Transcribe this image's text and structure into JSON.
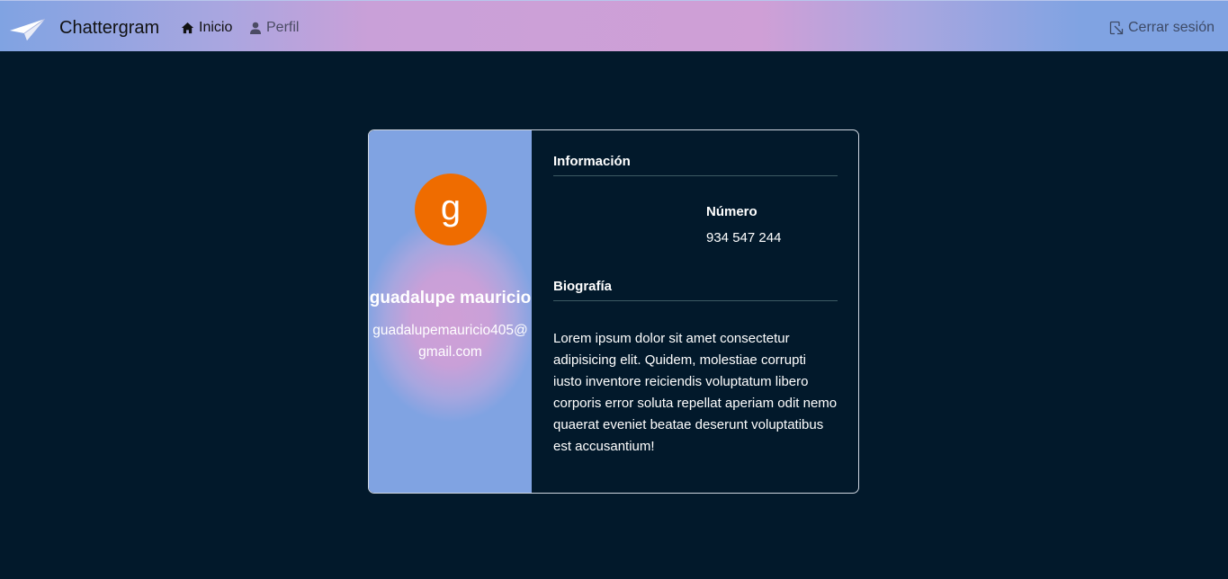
{
  "navbar": {
    "brand": "Chattergram",
    "links": [
      {
        "label": "Inicio",
        "icon": "home-icon"
      },
      {
        "label": "Perfil",
        "icon": "user-icon"
      }
    ],
    "logout": {
      "label": "Cerrar sesión",
      "icon": "logout-icon"
    }
  },
  "profile": {
    "avatar_letter": "g",
    "avatar_color": "#ef6c00",
    "name": "guadalupe mauricio",
    "email_line1": "guadalupemauricio405@",
    "email_line2": "gmail.com"
  },
  "info": {
    "section_title": "Información",
    "number_label": "Número",
    "number_value": "934 547 244"
  },
  "bio": {
    "section_title": "Biografía",
    "text": "Lorem ipsum dolor sit amet consectetur adipisicing elit. Quidem, molestiae corrupti iusto inventore reiciendis voluptatum libero corporis error soluta repellat aperiam odit nemo quaerat eveniet beatae deserunt voluptatibus est accusantium!"
  }
}
